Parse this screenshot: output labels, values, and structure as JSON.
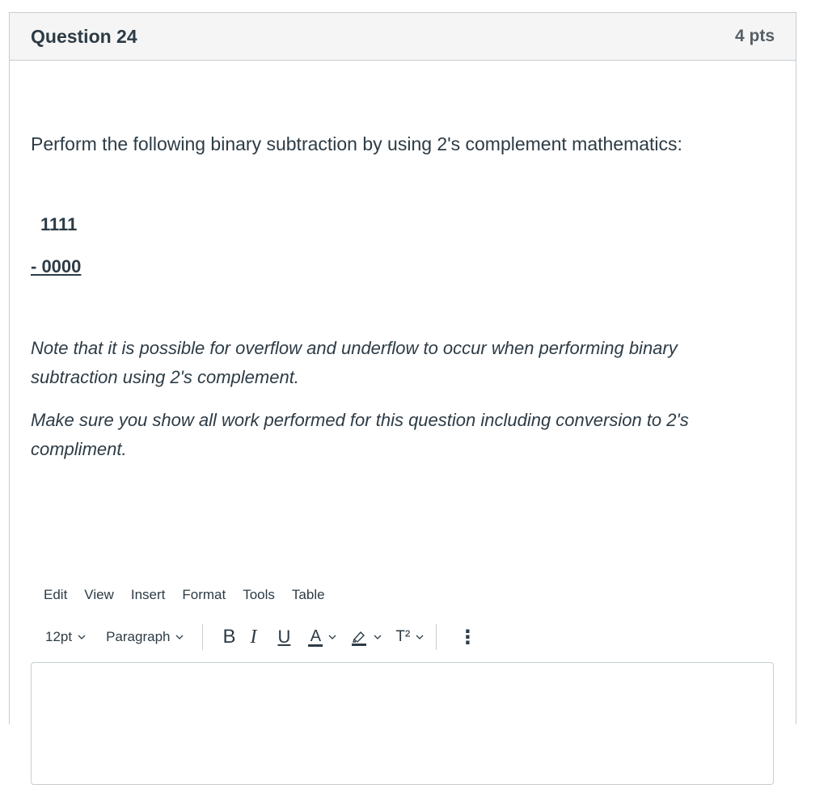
{
  "question": {
    "title": "Question 24",
    "points": "4 pts",
    "prompt": "Perform the following binary subtraction by using 2's complement mathematics:",
    "minuend": "1111",
    "subtrahend": "- 0000",
    "note": "Note that it is possible for overflow and underflow to occur when performing binary subtraction using 2's complement.",
    "instruction": "Make sure you show all work performed for this question including conversion to 2's compliment."
  },
  "editor": {
    "menu": [
      "Edit",
      "View",
      "Insert",
      "Format",
      "Tools",
      "Table"
    ],
    "font_size": "12pt",
    "block_format": "Paragraph",
    "bold_label": "B",
    "italic_label": "I",
    "underline_label": "U",
    "text_color_label": "A",
    "superscript_label": "T²",
    "more_label": "⋮",
    "text_color_bar": "#2d3b45",
    "answer": ""
  }
}
